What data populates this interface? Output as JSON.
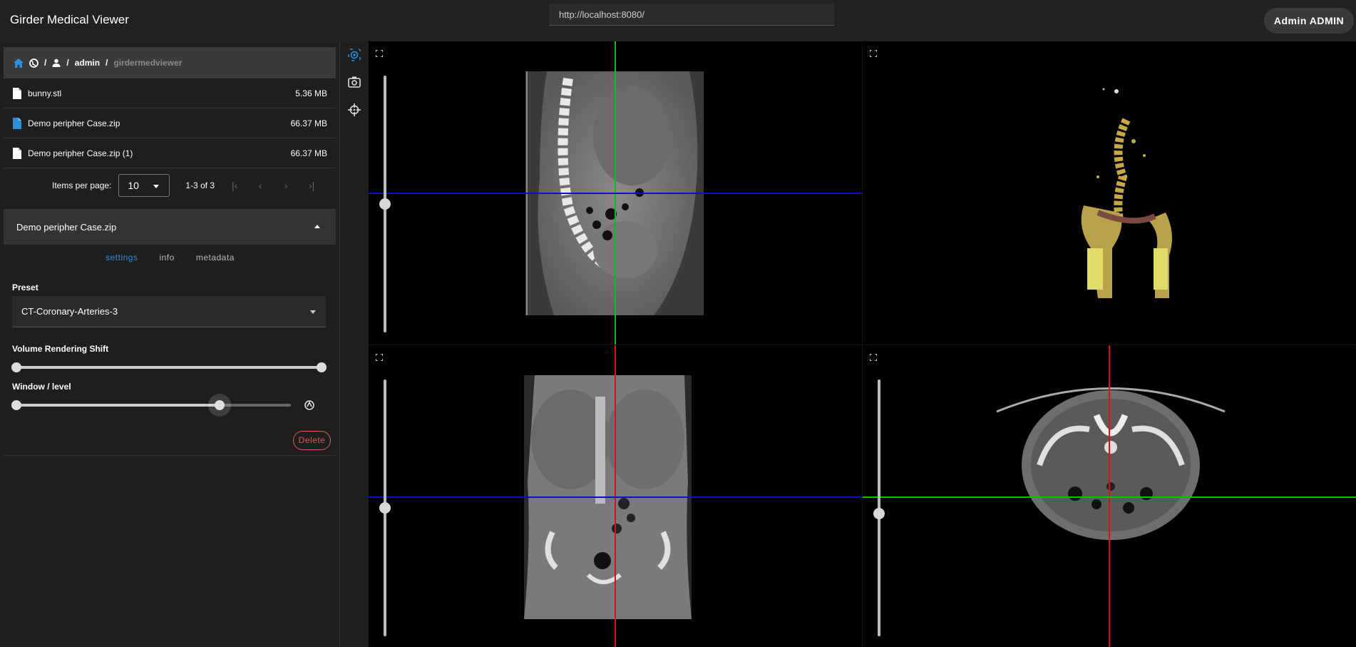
{
  "header": {
    "app_title": "Girder Medical Viewer",
    "url": "http://localhost:8080/",
    "user_button": "Admin ADMIN"
  },
  "breadcrumb": {
    "items": [
      {
        "icon": "home-icon"
      },
      {
        "icon": "globe-icon"
      },
      {
        "icon": "user-icon"
      },
      {
        "label": "admin"
      },
      {
        "label": "girdermedviewer"
      }
    ]
  },
  "files": [
    {
      "name": "bunny.stl",
      "size": "5.36 MB",
      "icon_color": "#ffffff"
    },
    {
      "name": "Demo peripher Case.zip",
      "size": "66.37 MB",
      "icon_color": "#2f8fd8"
    },
    {
      "name": "Demo peripher Case.zip (1)",
      "size": "66.37 MB",
      "icon_color": "#ffffff"
    }
  ],
  "pager": {
    "items_per_page_label": "Items per page:",
    "items_per_page_value": "10",
    "range": "1-3 of 3"
  },
  "panel": {
    "title": "Demo peripher Case.zip",
    "tabs": [
      {
        "label": "settings",
        "active": true
      },
      {
        "label": "info",
        "active": false
      },
      {
        "label": "metadata",
        "active": false
      }
    ],
    "preset_label": "Preset",
    "preset_value": "CT-Coronary-Arteries-3",
    "vr_shift_label": "Volume Rendering Shift",
    "vr_shift_range": [
      0,
      1
    ],
    "window_level_label": "Window / level",
    "window_level_value": 0.74,
    "delete_label": "Delete"
  },
  "toolbar": {
    "tools": [
      "reset-camera-icon",
      "screenshot-icon",
      "crosshair-icon"
    ],
    "active_color": "#2f8fd8"
  },
  "views": {
    "sagittal": {
      "slice": 0.6,
      "hline_color": "#1010c8",
      "vline_color": "#00c800"
    },
    "volume_3d": {},
    "coronal": {
      "slice": 0.6,
      "hline_color": "#1010c8",
      "vline_color": "#e01010"
    },
    "axial": {
      "slice": 0.56,
      "hline_color": "#00c800",
      "vline_color": "#e01010"
    }
  }
}
